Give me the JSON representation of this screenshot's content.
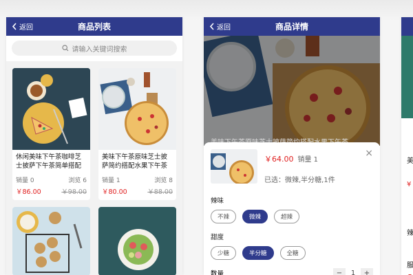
{
  "list_screen": {
    "back_label": "返回",
    "title": "商品列表",
    "search_placeholder": "请输入关键词搜索",
    "products": [
      {
        "name": "休闲美味下午茶咖啡芝士披萨下午茶简单搭配",
        "sales": "销量 0",
        "views": "浏览 6",
        "price": "￥86.00",
        "old_price": "￥98.00"
      },
      {
        "name": "美味下午茶原味芝士披萨简约搭配水果下午茶",
        "sales": "销量 1",
        "views": "浏览 8",
        "price": "￥80.00",
        "old_price": "￥88.00"
      }
    ]
  },
  "detail_screen": {
    "back_label": "返回",
    "title": "商品详情",
    "hero_caption": "美味下午茶原味芝士披萨简约搭配水果下午茶",
    "close_glyph": "×",
    "price": "￥64.00",
    "sales": "销量 1",
    "selected": "已选：微辣,半分糖,1件",
    "spice": {
      "label": "辣味",
      "options": [
        "不辣",
        "微辣",
        "超辣"
      ],
      "selected": "微辣"
    },
    "sugar": {
      "label": "甜度",
      "options": [
        "少糖",
        "半分糖",
        "全糖"
      ],
      "selected": "半分糖"
    },
    "quantity": {
      "label": "数量",
      "minus": "−",
      "value": "1",
      "plus": "+"
    }
  },
  "third_screen": {
    "snippets": [
      "美",
      "辣",
      "服"
    ]
  },
  "colors": {
    "primary": "#2f3b8c",
    "price": "#e02020"
  }
}
